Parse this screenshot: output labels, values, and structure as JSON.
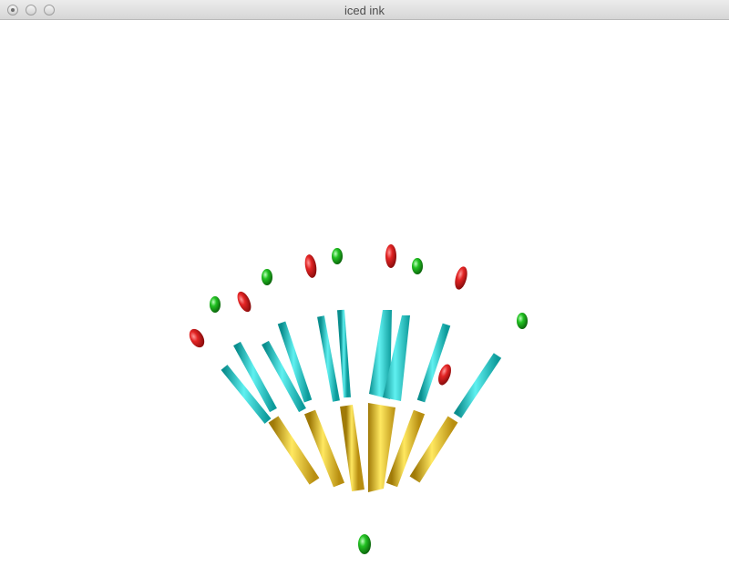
{
  "window": {
    "title": "iced ink"
  },
  "colors": {
    "background": "#ffffff",
    "cyan": "#1ec8c8",
    "gold": "#e8c020",
    "red": "#e02828",
    "green": "#22b822"
  },
  "icons": {
    "close": "close-button-icon",
    "minimize": "minimize-button-icon",
    "zoom": "zoom-button-icon"
  }
}
